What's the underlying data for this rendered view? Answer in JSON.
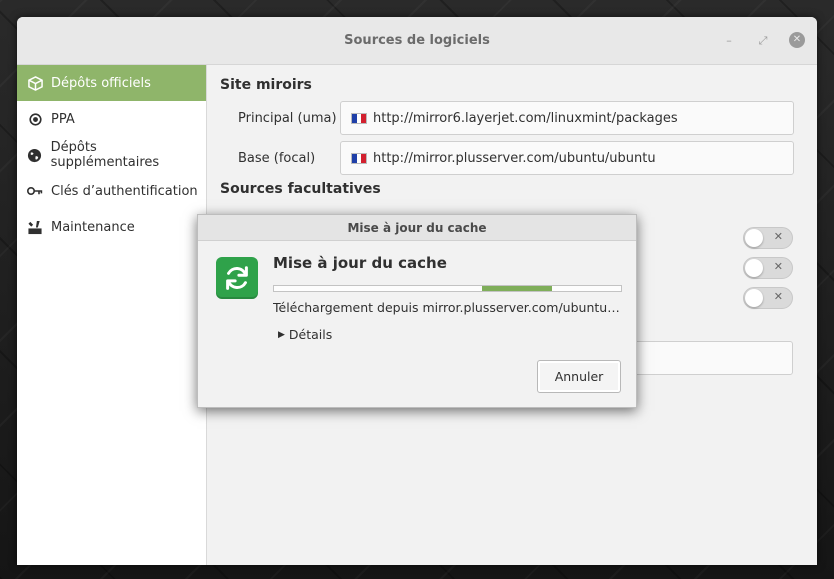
{
  "window": {
    "title": "Sources de logiciels",
    "controls": {
      "minimize": "–",
      "maximize": "⤢",
      "close": "✕"
    }
  },
  "sidebar": {
    "items": [
      {
        "label": "Dépôts officiels",
        "icon": "package-icon",
        "active": true
      },
      {
        "label": "PPA",
        "icon": "ppa-dot-icon",
        "active": false
      },
      {
        "label": "Dépôts supplémentaires",
        "icon": "globe-icon",
        "active": false
      },
      {
        "label": "Clés d’authentification",
        "icon": "key-icon",
        "active": false
      },
      {
        "label": "Maintenance",
        "icon": "tools-icon",
        "active": false
      }
    ]
  },
  "main": {
    "mirrors_title": "Site miroirs",
    "mirrors": [
      {
        "label": "Principal (uma)",
        "url": "http://mirror6.layerjet.com/linuxmint/packages"
      },
      {
        "label": "Base (focal)",
        "url": "http://mirror.plusserver.com/ubuntu/ubuntu"
      }
    ],
    "optional_title": "Sources facultatives"
  },
  "dialog": {
    "title": "Mise à jour du cache",
    "heading": "Mise à jour du cache",
    "status": "Téléchargement depuis mirror.plusserver.com/ubuntu/ubuntu",
    "details_label": "Détails",
    "cancel_label": "Annuler",
    "progress": {
      "start": 0.6,
      "end": 0.8
    }
  },
  "colors": {
    "accent": "#8fb56a",
    "dialog_icon": "#2fa24a",
    "progress": "#7fae5a"
  }
}
